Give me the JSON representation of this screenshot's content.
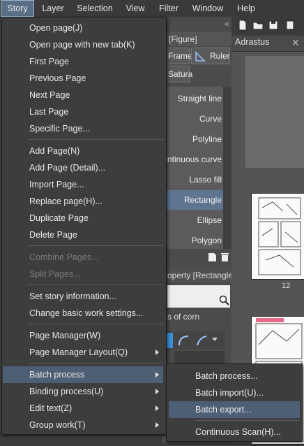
{
  "menubar": {
    "items": [
      "Story",
      "Layer",
      "Selection",
      "View",
      "Filter",
      "Window",
      "Help"
    ]
  },
  "background": {
    "navigator_title": "Adrastus",
    "navigator_close": "✕",
    "page_number": "12",
    "tool_panel_tab": "l [Figure]",
    "frame_button": "Frame",
    "ruler_button": "Ruler",
    "satura_button": "Satura",
    "brush_items": [
      "Straight line",
      "Curve",
      "Polyline",
      "ontinuous curve",
      "Lasso fill",
      "Rectangle",
      "Ellipse",
      "Polygon"
    ],
    "selected_brush": "Rectangle",
    "property_title": "operty [Rectangle",
    "property_line": "s of corn"
  },
  "story_menu": {
    "groups": [
      [
        "Open page(J)",
        "Open page with new tab(K)",
        "First Page",
        "Previous Page",
        "Next Page",
        "Last Page",
        "Specific Page..."
      ],
      [
        "Add Page(N)",
        "Add Page (Detail)...",
        "Import Page...",
        "Replace page(H)...",
        "Duplicate Page",
        "Delete Page"
      ],
      [
        "Combine Pages...",
        "Split Pages..."
      ],
      [
        "Set story information...",
        "Change basic work settings..."
      ],
      [
        "Page Manager(W)",
        "Page Manager Layout(Q)"
      ],
      [
        "Batch process",
        "Binding process(U)",
        "Edit text(Z)",
        "Group work(T)"
      ]
    ],
    "disabled": [
      "Combine Pages...",
      "Split Pages..."
    ],
    "highlighted": "Batch process"
  },
  "batch_submenu": {
    "items": [
      "Batch process...",
      "Batch import(U)...",
      "Batch export...",
      "Continuous Scan(H)..."
    ],
    "highlighted": "Batch export..."
  },
  "colors": {
    "menu_bg": "#3d3d3d",
    "highlight": "#4d5f75",
    "active_menubar": "#5a6f86"
  }
}
